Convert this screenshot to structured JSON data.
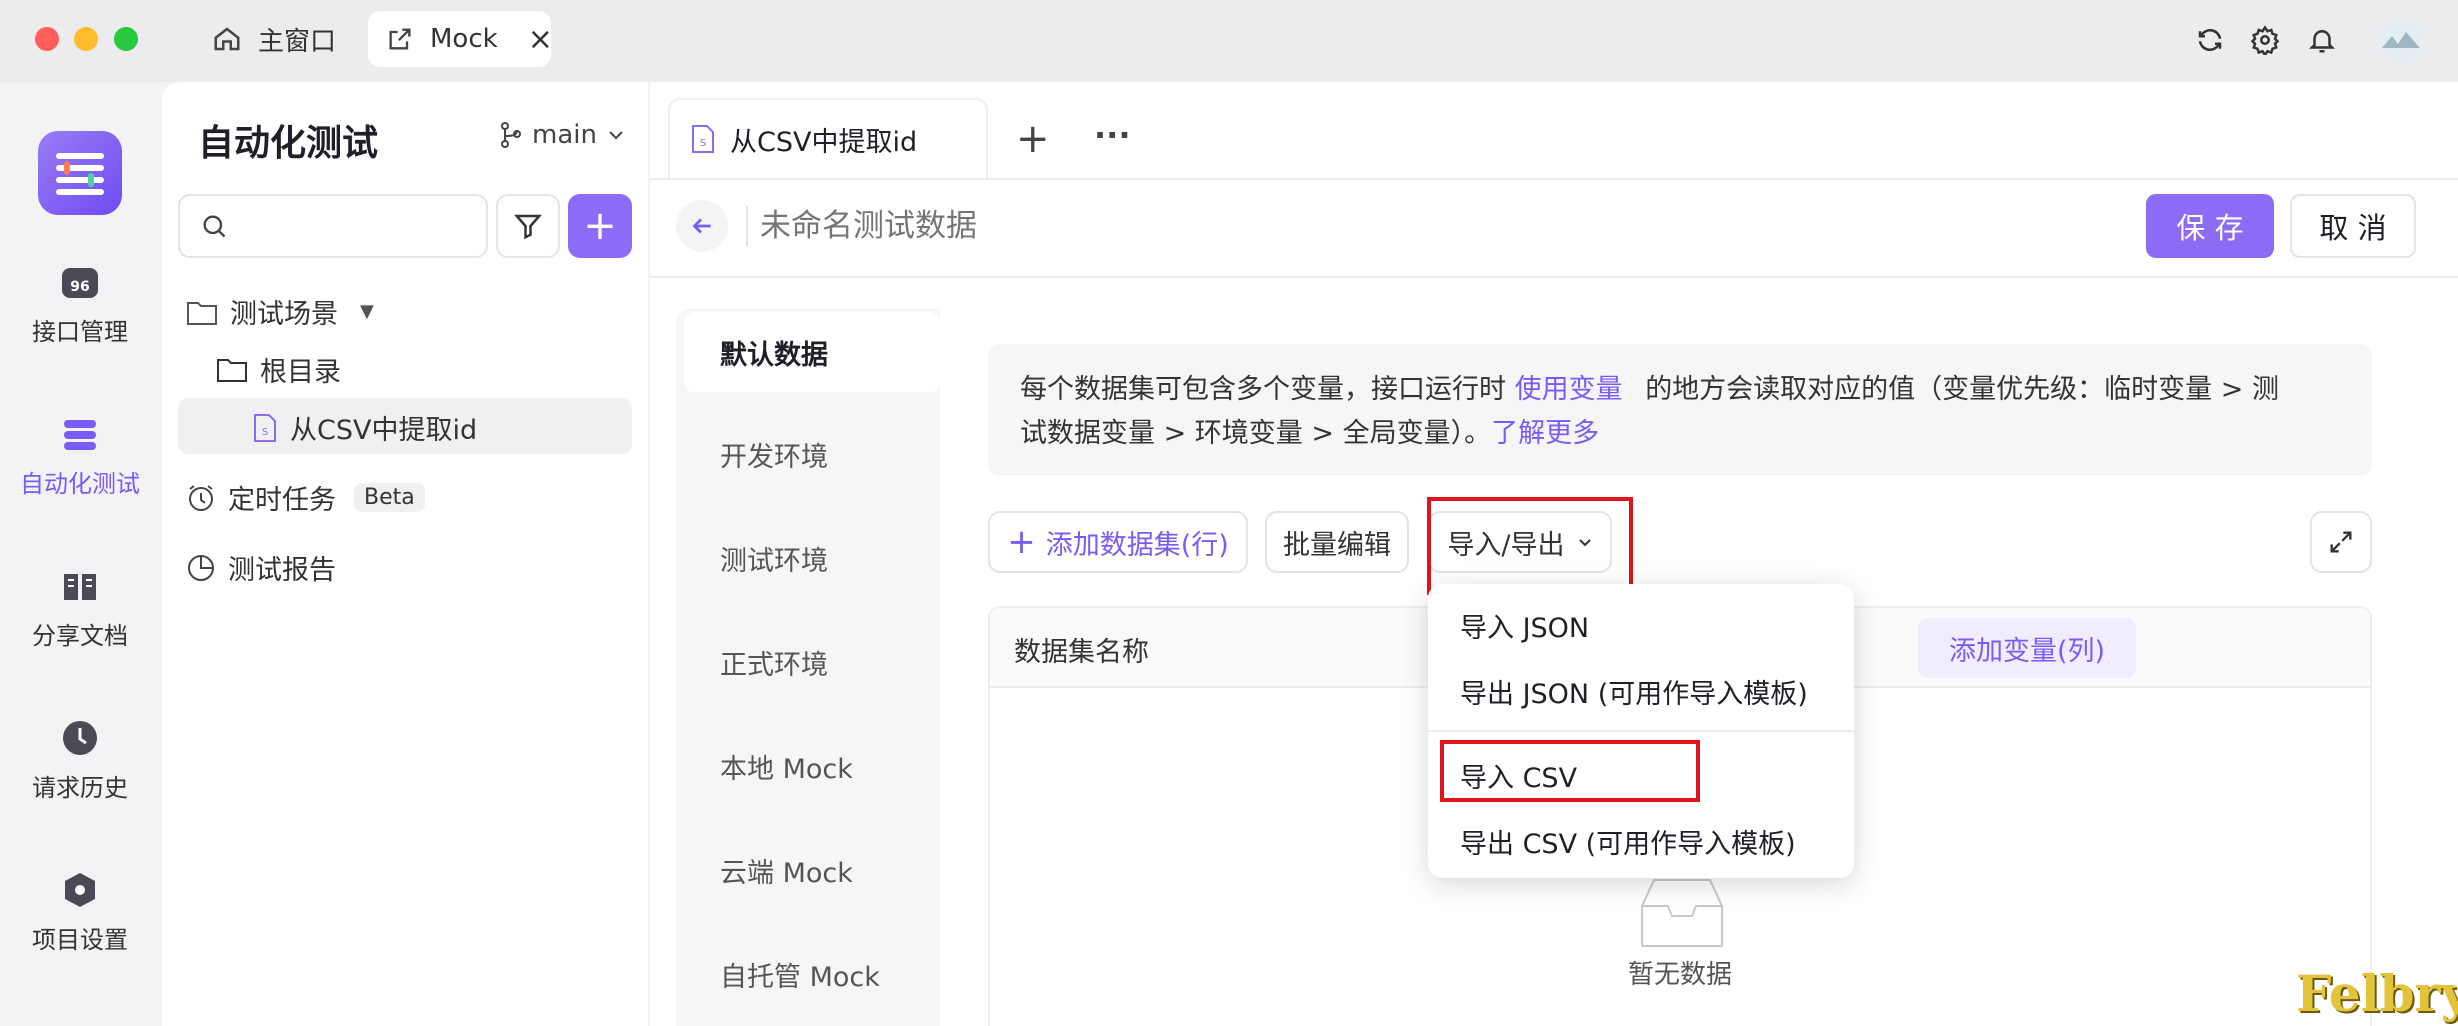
{
  "titlebar": {
    "home_tab": "主窗口",
    "active_tab": "Mock",
    "close": "×"
  },
  "rail": {
    "items": [
      {
        "label": "接口管理",
        "icon": "api-icon"
      },
      {
        "label": "自动化测试",
        "icon": "automation-icon"
      },
      {
        "label": "分享文档",
        "icon": "book-icon"
      },
      {
        "label": "请求历史",
        "icon": "clock-icon"
      },
      {
        "label": "项目设置",
        "icon": "hexagon-icon"
      }
    ]
  },
  "sidebar": {
    "title": "自动化测试",
    "branch": "main",
    "search_placeholder": "",
    "add": "+",
    "scenes_label": "测试场景",
    "root_label": "根目录",
    "scene_item": "从CSV中提取id",
    "scheduled_label": "定时任务",
    "beta_badge": "Beta",
    "report_label": "测试报告"
  },
  "editor": {
    "tab_label": "从CSV中提取id",
    "add_tab": "+",
    "more": "···",
    "name_placeholder": "未命名测试数据",
    "save_label": "保 存",
    "cancel_label": "取 消"
  },
  "env_tabs": [
    "默认数据",
    "开发环境",
    "测试环境",
    "正式环境",
    "本地 Mock",
    "云端 Mock",
    "自托管 Mock"
  ],
  "info": {
    "text_a": "每个数据集可包含多个变量，接口运行时",
    "link_use_var": "使用变量",
    "text_b": "的地方会读取对应的值（变量优先级：临时变量 > 测",
    "text_c": "试数据变量 > 环境变量 > 全局变量）。",
    "link_more": "了解更多"
  },
  "toolbar": {
    "add_dataset": "添加数据集(行)",
    "batch_edit": "批量编辑",
    "import_export": "导入/导出"
  },
  "table": {
    "col_name": "数据集名称",
    "add_var": "添加变量(列)",
    "empty": "暂无数据"
  },
  "menu": {
    "items": [
      "导入 JSON",
      "导出 JSON (可用作导入模板)",
      "导入 CSV",
      "导出 CSV (可用作导入模板)"
    ]
  },
  "watermark": "Felbry",
  "colors": {
    "accent": "#7a5af8",
    "highlight": "#e0151b",
    "watermark": "#e3c33a"
  }
}
